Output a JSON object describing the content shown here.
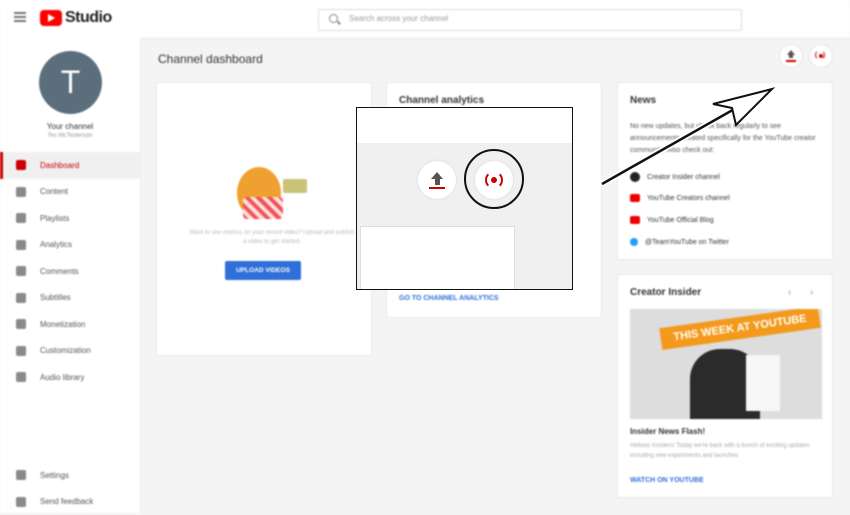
{
  "app": {
    "logo_text": "Studio"
  },
  "search": {
    "placeholder": "Search across your channel"
  },
  "channel": {
    "initial": "T",
    "name": "Your channel",
    "subtitle": "Tes McTesterson"
  },
  "sidebar": {
    "items": [
      {
        "label": "Dashboard",
        "icon": "dashboard-icon",
        "active": true
      },
      {
        "label": "Content",
        "icon": "content-icon"
      },
      {
        "label": "Playlists",
        "icon": "playlists-icon"
      },
      {
        "label": "Analytics",
        "icon": "analytics-icon"
      },
      {
        "label": "Comments",
        "icon": "comments-icon"
      },
      {
        "label": "Subtitles",
        "icon": "subtitles-icon"
      },
      {
        "label": "Monetization",
        "icon": "monetization-icon"
      },
      {
        "label": "Customization",
        "icon": "customization-icon"
      },
      {
        "label": "Audio library",
        "icon": "audio-library-icon"
      }
    ],
    "bottom": [
      {
        "label": "Settings",
        "icon": "gear-icon"
      },
      {
        "label": "Send feedback",
        "icon": "feedback-icon"
      }
    ]
  },
  "main": {
    "title": "Channel dashboard"
  },
  "upload_card": {
    "text": "Want to see metrics on your recent video? Upload and publish a video to get started.",
    "button": "UPLOAD VIDEOS"
  },
  "analytics_card": {
    "title": "Channel analytics",
    "link": "GO TO CHANNEL ANALYTICS"
  },
  "news": {
    "title": "News",
    "text": "No new updates, but check back regularly to see announcements created specifically for the YouTube creator community. Also check out:",
    "links": [
      {
        "label": "Creator Insider channel",
        "icon": "creator-insider-icon"
      },
      {
        "label": "YouTube Creators channel",
        "icon": "youtube-icon"
      },
      {
        "label": "YouTube Official Blog",
        "icon": "youtube-icon"
      },
      {
        "label": "@TeamYouTube on Twitter",
        "icon": "twitter-icon"
      }
    ]
  },
  "insider": {
    "title": "Creator Insider",
    "thumb_banner": "THIS WEEK AT YOUTUBE",
    "video_title": "Insider News Flash!",
    "video_text": "Hellooo Insiders! Today we're back with a bunch of exciting updates including new experiments and launches",
    "link": "WATCH ON YOUTUBE"
  },
  "colors": {
    "accent_red": "#cc0000",
    "link_blue": "#2e6fd8",
    "youtube_red": "#ff0000"
  }
}
